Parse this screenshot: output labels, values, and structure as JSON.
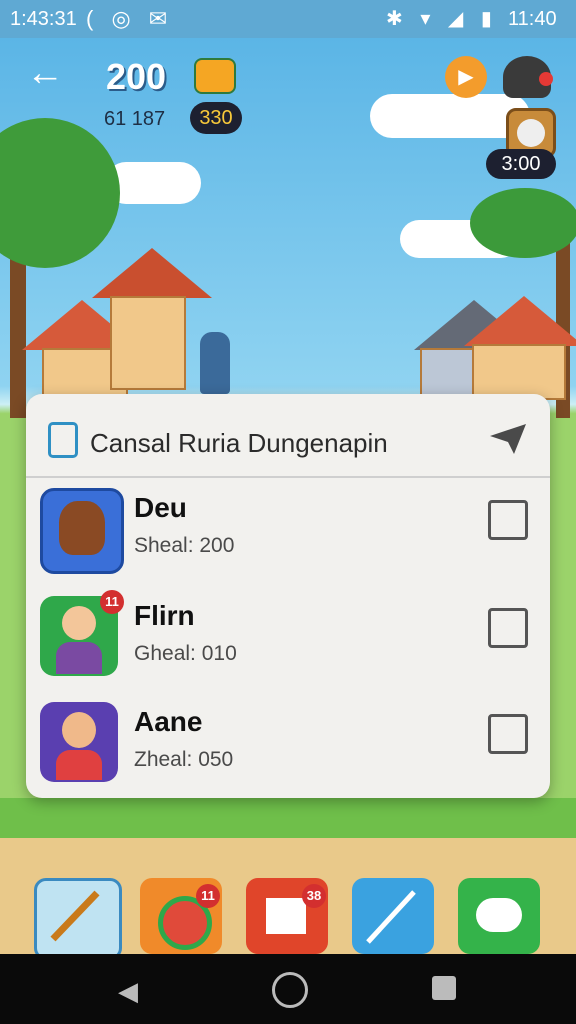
{
  "status_bar": {
    "time": "1:43:31",
    "left_icons": "( ◎ ✉",
    "right_icons": "✱ ▾ ◢ ▮",
    "clock": "11:40"
  },
  "hud": {
    "back_icon": "←",
    "coins": "200",
    "sub_value": "61 187",
    "pill_value": "330",
    "play_icon": "▶",
    "timer": "3:00"
  },
  "panel": {
    "title": "Cansal Ruria Dungenapin",
    "rows": [
      {
        "name": "Deu",
        "score": "Sheal: 200",
        "badge": ""
      },
      {
        "name": "Flirn",
        "score": "Gheal: 010",
        "badge": "11"
      },
      {
        "name": "Aane",
        "score": "Zheal: 050",
        "badge": ""
      }
    ]
  },
  "dock": {
    "badges": [
      "11",
      "38"
    ]
  },
  "nav": {
    "back": "◀",
    "home": "●",
    "recents": "■"
  },
  "colors": {
    "accent": "#f39c2c",
    "panel": "#f2f1ee",
    "sky": "#5bb5e6"
  }
}
